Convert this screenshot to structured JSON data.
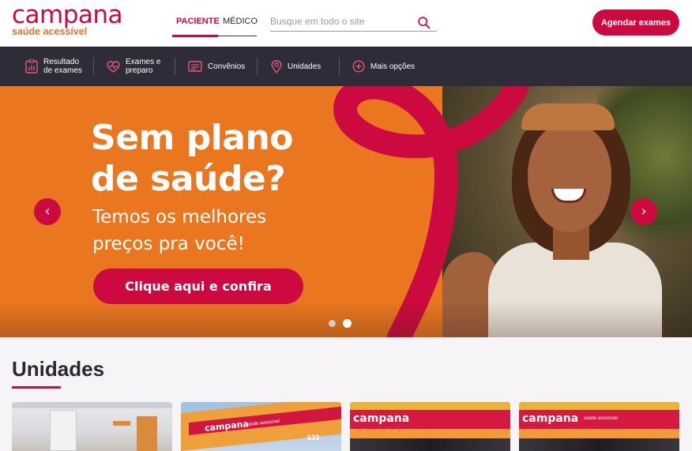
{
  "brand": {
    "logo_word": "campana",
    "logo_tagline": "saúde acessível",
    "primary_color": "#cc0a3f",
    "accent_color": "#e3732a",
    "nav_bg_color": "#2f2c3a"
  },
  "header": {
    "tabs": [
      {
        "label": "PACIENTE",
        "active": true
      },
      {
        "label": "MÉDICO",
        "active": false
      }
    ],
    "search": {
      "placeholder": "Busque em todo o site",
      "value": "",
      "icon": "search-icon"
    },
    "cta_label": "Agendar exames"
  },
  "nav": {
    "items": [
      {
        "label_line1": "Resultado",
        "label_line2": "de exames",
        "icon": "clipboard-chart-icon"
      },
      {
        "label_line1": "Exames e",
        "label_line2": "preparo",
        "icon": "heart-pulse-icon"
      },
      {
        "label": "Convênios",
        "icon": "id-card-icon"
      },
      {
        "label": "Unidades",
        "icon": "location-pin-icon"
      },
      {
        "label": "Mais opções",
        "icon": "plus-circle-icon"
      }
    ]
  },
  "hero": {
    "headline_line1": "Sem plano",
    "headline_line2": "de saúde?",
    "subline_line1": "Temos os melhores",
    "subline_line2": "preços pra você!",
    "button_label": "Clique aqui e confira",
    "prev_label": "‹",
    "next_label": "›",
    "slide_count": 2,
    "active_slide": 2
  },
  "unidades": {
    "title": "Unidades",
    "cards": [
      {
        "image": "clinic-interior-photo"
      },
      {
        "image": "clinic-facade-photo",
        "brand_text": "campana",
        "tagline": "saúde acessível",
        "number": "633"
      },
      {
        "image": "clinic-facade-photo",
        "brand_text": "campana"
      },
      {
        "image": "clinic-facade-photo",
        "brand_text": "campana",
        "tagline": "saúde acessível"
      }
    ]
  }
}
